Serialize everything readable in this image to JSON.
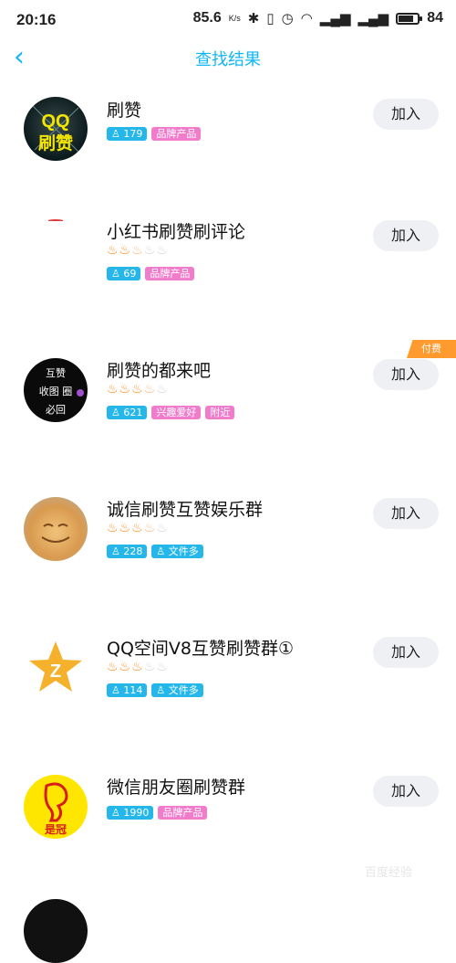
{
  "status": {
    "time": "20:16",
    "speed": "85.6",
    "speed_unit": "K/s",
    "battery": "84"
  },
  "header": {
    "title": "查找结果"
  },
  "join_label": "加入",
  "paid_label": "付费",
  "groups": [
    {
      "name": "刷赞",
      "members": "179",
      "tags": [
        "品牌产品"
      ],
      "flames": null,
      "avatar_text": "QQ 刷赞"
    },
    {
      "name": "小红书刷赞刷评论",
      "members": "69",
      "tags": [
        "品牌产品"
      ],
      "flames": 2.5,
      "avatar_text": ""
    },
    {
      "name": "刷赞的都来吧",
      "members": "621",
      "tags": [
        "兴趣爱好",
        "附近"
      ],
      "flames": 3.5,
      "avatar_text": "互赞 收图 必回"
    },
    {
      "name": "诚信刷赞互赞娱乐群",
      "members": "228",
      "tags": [
        "文件多"
      ],
      "flames": 3.5,
      "avatar_text": ""
    },
    {
      "name": "QQ空间V8互赞刷赞群①",
      "members": "114",
      "tags": [
        "文件多"
      ],
      "flames": 3,
      "avatar_text": "Z"
    },
    {
      "name": "微信朋友圈刷赞群",
      "members": "1990",
      "tags": [
        "品牌产品"
      ],
      "flames": null,
      "avatar_text": "是冠"
    }
  ],
  "watermark": "百度经验"
}
